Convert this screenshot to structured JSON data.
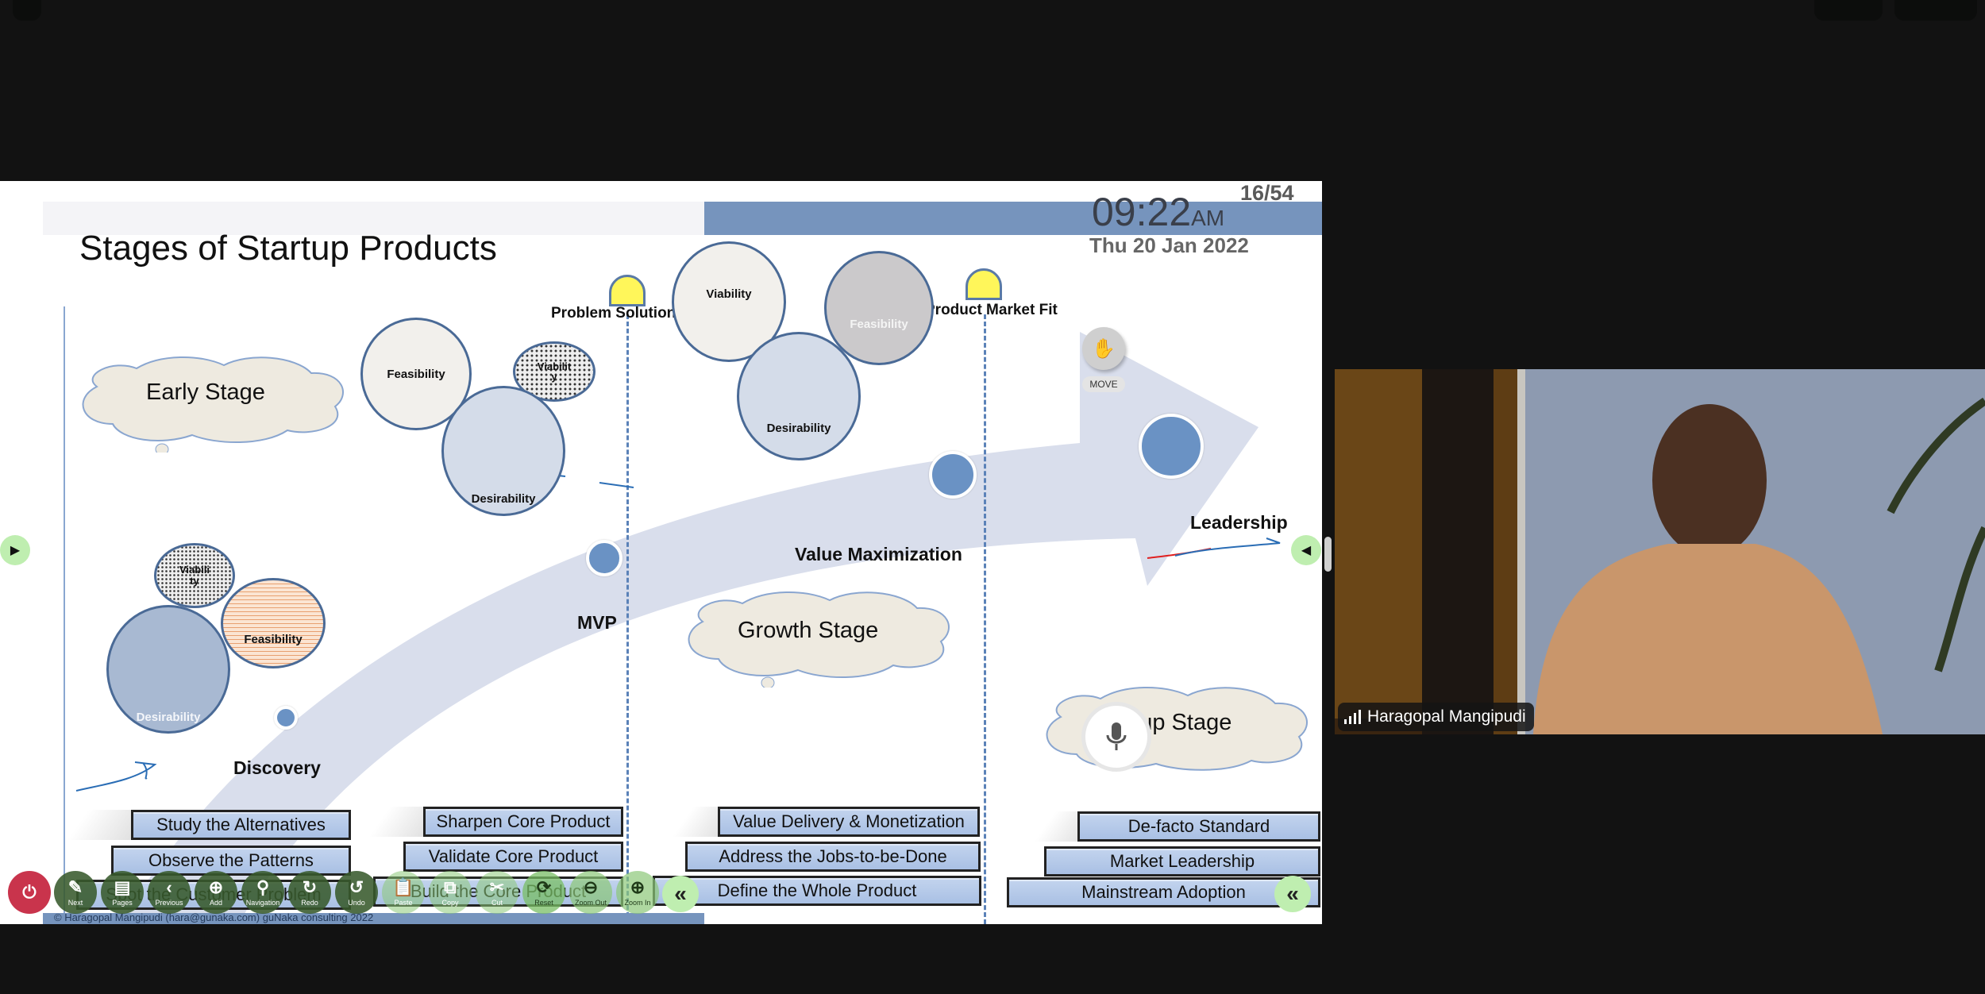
{
  "slide": {
    "title": "Stages of Startup Products",
    "clock": {
      "time": "09:22",
      "ampm": "AM",
      "date": "Thu 20 Jan 2022"
    },
    "page_counter": "16/54",
    "milestones": [
      "Problem Solution Fit",
      "Product Market Fit"
    ],
    "path_labels": {
      "discovery": "Discovery",
      "mvp": "MVP",
      "value_max": "Value Maximization",
      "leadership": "Leadership"
    },
    "stage_clouds": [
      "Early Stage",
      "Growth Stage",
      "Startup Stage"
    ],
    "circle_groups": {
      "discovery": [
        "Viability",
        "Feasibility",
        "Desirability"
      ],
      "early": [
        "Feasibility",
        "Viability",
        "Desirability"
      ],
      "growth": [
        "Viability",
        "Feasibility",
        "Desirability"
      ]
    },
    "step_columns": [
      [
        "Study the Alternatives",
        "Observe the Patterns",
        "Spot the Customer Problem"
      ],
      [
        "Sharpen Core Product",
        "Validate Core Product",
        "Build the Core Product"
      ],
      [
        "Value Delivery & Monetization",
        "Address the Jobs-to-be-Done",
        "Define the Whole Product"
      ],
      [
        "De-facto Standard",
        "Market Leadership",
        "Mainstream Adoption"
      ]
    ],
    "footer": "© Haragopal Mangipudi (hara@gunaka.com) guNaka consulting 2022",
    "colors": {
      "accent_blue": "#7694bd",
      "bulb_yellow": "#fff65a",
      "path_fill": "#d9deec",
      "dot_blue": "#6a92c4"
    }
  },
  "toolbar": {
    "power_icon": "power-icon",
    "buttons": [
      {
        "label": "Next",
        "icon": "tool-icon"
      },
      {
        "label": "Pages",
        "icon": "document-icon"
      },
      {
        "label": "Previous",
        "icon": "chevron-left-icon"
      },
      {
        "label": "Add",
        "icon": "plus-icon"
      },
      {
        "label": "Navigation",
        "icon": "location-pin-icon"
      },
      {
        "label": "Redo",
        "icon": "redo-icon"
      },
      {
        "label": "Undo",
        "icon": "undo-icon"
      },
      {
        "label": "Paste",
        "icon": "clipboard-icon"
      },
      {
        "label": "Copy",
        "icon": "copy-icon"
      },
      {
        "label": "Cut",
        "icon": "scissors-icon"
      },
      {
        "label": "Reset",
        "icon": "refresh-icon"
      },
      {
        "label": "Zoom Out",
        "icon": "zoom-out-icon"
      },
      {
        "label": "Zoom In",
        "icon": "zoom-in-icon"
      }
    ],
    "move_label": "MOVE"
  },
  "video": {
    "participant_name": "Haragopal Mangipudi"
  }
}
